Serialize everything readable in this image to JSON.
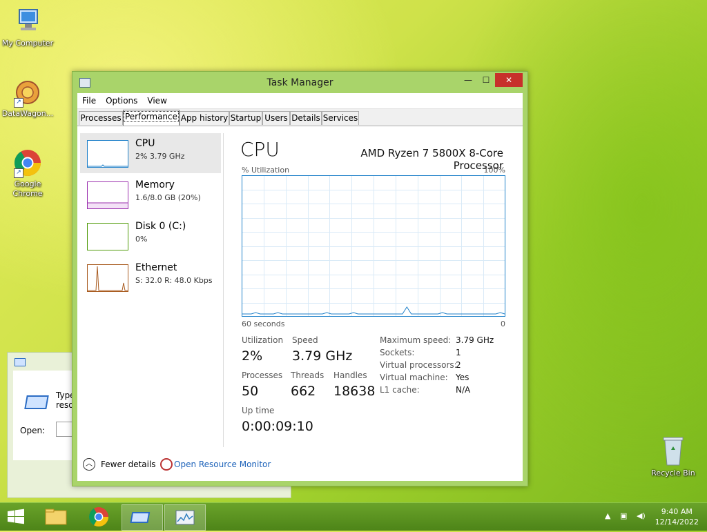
{
  "desktop": {
    "icons": [
      {
        "label": "My Computer"
      },
      {
        "label": "DataWagon..."
      },
      {
        "label": "Google Chrome"
      }
    ],
    "recycle_bin": "Recycle Bin"
  },
  "run_dialog": {
    "type_text_line1": "Type",
    "type_text_line2": "resou",
    "open_label": "Open:"
  },
  "window": {
    "title": "Task Manager",
    "controls": {
      "minimize": "—",
      "maximize": "☐",
      "close": "✕"
    },
    "menu": [
      "File",
      "Options",
      "View"
    ],
    "tabs": [
      "Processes",
      "Performance",
      "App history",
      "Startup",
      "Users",
      "Details",
      "Services"
    ],
    "active_tab": "Performance"
  },
  "sidebar": {
    "items": [
      {
        "name": "CPU",
        "sub": "2%  3.79 GHz",
        "color": "#1c7fc9"
      },
      {
        "name": "Memory",
        "sub": "1.6/8.0 GB (20%)",
        "color": "#9b2fae"
      },
      {
        "name": "Disk 0 (C:)",
        "sub": "0%",
        "color": "#4e9a06"
      },
      {
        "name": "Ethernet",
        "sub": "S: 32.0  R: 48.0 Kbps",
        "color": "#a85a1e"
      }
    ]
  },
  "main": {
    "title": "CPU",
    "model": "AMD Ryzen 7 5800X 8-Core Processor",
    "graph_top_left": "% Utilization",
    "graph_top_right": "100%",
    "graph_bottom_left": "60 seconds",
    "graph_bottom_right": "0",
    "utilization_history": [
      1,
      1,
      1,
      2,
      1,
      1,
      1,
      1,
      2,
      1,
      1,
      1,
      1,
      1,
      1,
      1,
      1,
      1,
      1,
      2,
      1,
      1,
      1,
      1,
      1,
      2,
      1,
      1,
      1,
      1,
      1,
      1,
      1,
      1,
      1,
      1,
      1,
      6,
      1,
      1,
      1,
      1,
      1,
      1,
      1,
      2,
      1,
      1,
      1,
      1,
      1,
      1,
      1,
      1,
      1,
      1,
      1,
      1,
      2,
      1
    ],
    "stats": {
      "utilization_label": "Utilization",
      "utilization": "2%",
      "speed_label": "Speed",
      "speed": "3.79 GHz",
      "processes_label": "Processes",
      "processes": "50",
      "threads_label": "Threads",
      "threads": "662",
      "handles_label": "Handles",
      "handles": "18638",
      "uptime_label": "Up time",
      "uptime": "0:00:09:10"
    },
    "specs": [
      {
        "k": "Maximum speed:",
        "v": "3.79 GHz"
      },
      {
        "k": "Sockets:",
        "v": "1"
      },
      {
        "k": "Virtual processors:",
        "v": "2"
      },
      {
        "k": "Virtual machine:",
        "v": "Yes"
      },
      {
        "k": "L1 cache:",
        "v": "N/A"
      }
    ]
  },
  "footer": {
    "fewer_details": "Fewer details",
    "open_resource_monitor": "Open Resource Monitor"
  },
  "taskbar": {
    "time": "9:40 AM",
    "date": "12/14/2022"
  }
}
